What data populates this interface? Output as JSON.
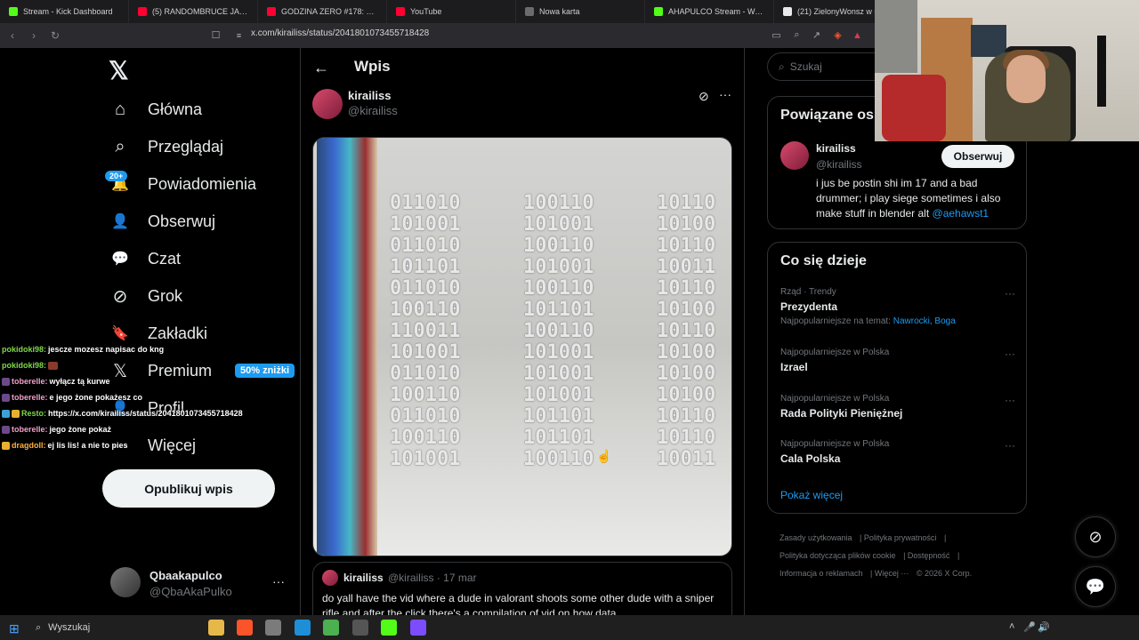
{
  "browser": {
    "tabs": [
      {
        "title": "Stream - Kick Dashboard",
        "fav_color": "#53fc18"
      },
      {
        "title": "(5) RANDOMBRUCE JAKO \"TOR",
        "fav_color": "#ff0033"
      },
      {
        "title": "GODZINA ZERO #178: KRZYSZ",
        "fav_color": "#ff0033"
      },
      {
        "title": "YouTube",
        "fav_color": "#ff0033"
      },
      {
        "title": "Nowa karta",
        "fav_color": "#6b6b6b"
      },
      {
        "title": "AHAPULCO Stream - Watch Li",
        "fav_color": "#53fc18"
      },
      {
        "title": "(21) ZielonyWonsz w serwisie",
        "fav_color": "#e7e9ea"
      }
    ],
    "url": "x.com/kirailiss/status/2041801073455718428"
  },
  "sidebar": {
    "logo": "𝕏",
    "notif_badge": "20+",
    "items": [
      {
        "label": "Główna",
        "icon": "⌂"
      },
      {
        "label": "Przeglądaj",
        "icon": "⌕"
      },
      {
        "label": "Powiadomienia",
        "icon": "🔔"
      },
      {
        "label": "Obserwuj",
        "icon": "👤"
      },
      {
        "label": "Czat",
        "icon": "💬"
      },
      {
        "label": "Grok",
        "icon": "⊘"
      },
      {
        "label": "Zakładki",
        "icon": "🔖"
      },
      {
        "label": "Premium",
        "icon": "𝕏"
      },
      {
        "label": "Profil",
        "icon": "👤"
      },
      {
        "label": "Więcej",
        "icon": "⋯"
      }
    ],
    "premium_promo": "50% zniżki",
    "post_button": "Opublikuj wpis",
    "account": {
      "name": "Qbaakapulco",
      "handle": "@QbaAkaPulko"
    }
  },
  "chat": [
    {
      "user": "pokidoki98:",
      "text": "jescze mozesz napisac do kng",
      "color": "#7fd84a"
    },
    {
      "user": "pokidoki98:",
      "text": "",
      "color": "#7fd84a",
      "emote": true
    },
    {
      "user": "toberelle:",
      "text": "wyłącz tą kurwe",
      "color": "#f0a0c8"
    },
    {
      "user": "toberelle:",
      "text": "e jego żone pokażesz co",
      "color": "#f0a0c8"
    },
    {
      "user": "Resto:",
      "text": "https://x.com/kirailiss/status/2041801073455718428",
      "color": "#7fd84a"
    },
    {
      "user": "toberelle:",
      "text": "jego żone pokaż",
      "color": "#f0a0c8"
    },
    {
      "user": "dragdoll:",
      "text": "ej lis  lis! a nie to pies",
      "color": "#ffb040"
    }
  ],
  "main": {
    "back_icon": "←",
    "title": "Wpis",
    "author": {
      "name": "kirailiss",
      "handle": "@kirailiss"
    },
    "binary_columns": [
      "011010\n101001\n011010\n101101\n011010\n100110\n110011\n101001\n011010\n100110\n011010\n100110\n101001",
      "100110\n101001\n100110\n101001\n100110\n101101\n100110\n101001\n101001\n101001\n101101\n101101\n100110",
      "10110\n10100\n10110\n10011\n10110\n10100\n10110\n10100\n10100\n10100\n10110\n10110\n10011"
    ],
    "quote": {
      "name": "kirailiss",
      "handle": "@kirailiss · 17 mar",
      "text": "do yall have the vid where a dude in valorant shoots some other dude with a sniper rifle and after the click there's a compilation of vid on how data"
    }
  },
  "right": {
    "search_placeholder": "Szukaj",
    "related_title": "Powiązane os",
    "related": {
      "name": "kirailiss",
      "handle": "@kirailiss",
      "follow": "Obserwuj",
      "bio": "i jus be postin shi im 17 and a bad drummer; i play siege sometimes i also make stuff in blender alt ",
      "bio_mention": "@aehawst1"
    },
    "trends_title": "Co się dzieje",
    "trends": [
      {
        "context": "Rząd · Trendy",
        "name": "Prezydenta",
        "sub": "Najpopularniejsze na temat: ",
        "sub_link": "Nawrocki, Boga"
      },
      {
        "context": "Najpopularniejsze w Polska",
        "name": "Izrael",
        "sub": "",
        "sub_link": ""
      },
      {
        "context": "Najpopularniejsze w Polska",
        "name": "Rada Polityki Pieniężnej",
        "sub": "",
        "sub_link": ""
      },
      {
        "context": "Najpopularniejsze w Polska",
        "name": "Cala Polska",
        "sub": "",
        "sub_link": ""
      }
    ],
    "show_more": "Pokaż więcej",
    "footer": {
      "l1": "Zasady użytkowania",
      "l2": "Polityka prywatności",
      "l3": "Polityka dotycząca plików cookie",
      "l4": "Dostępność",
      "l5": "Informacja o reklamach",
      "l6": "Więcej ···",
      "l7": "© 2026 X Corp."
    }
  },
  "taskbar": {
    "search": "Wyszukaj",
    "apps": [
      "#e6b84a",
      "#fb542b",
      "#7b7b7b",
      "#1e8fd6",
      "#4caf50",
      "#555555",
      "#53fc18",
      "#7c4dff"
    ]
  }
}
